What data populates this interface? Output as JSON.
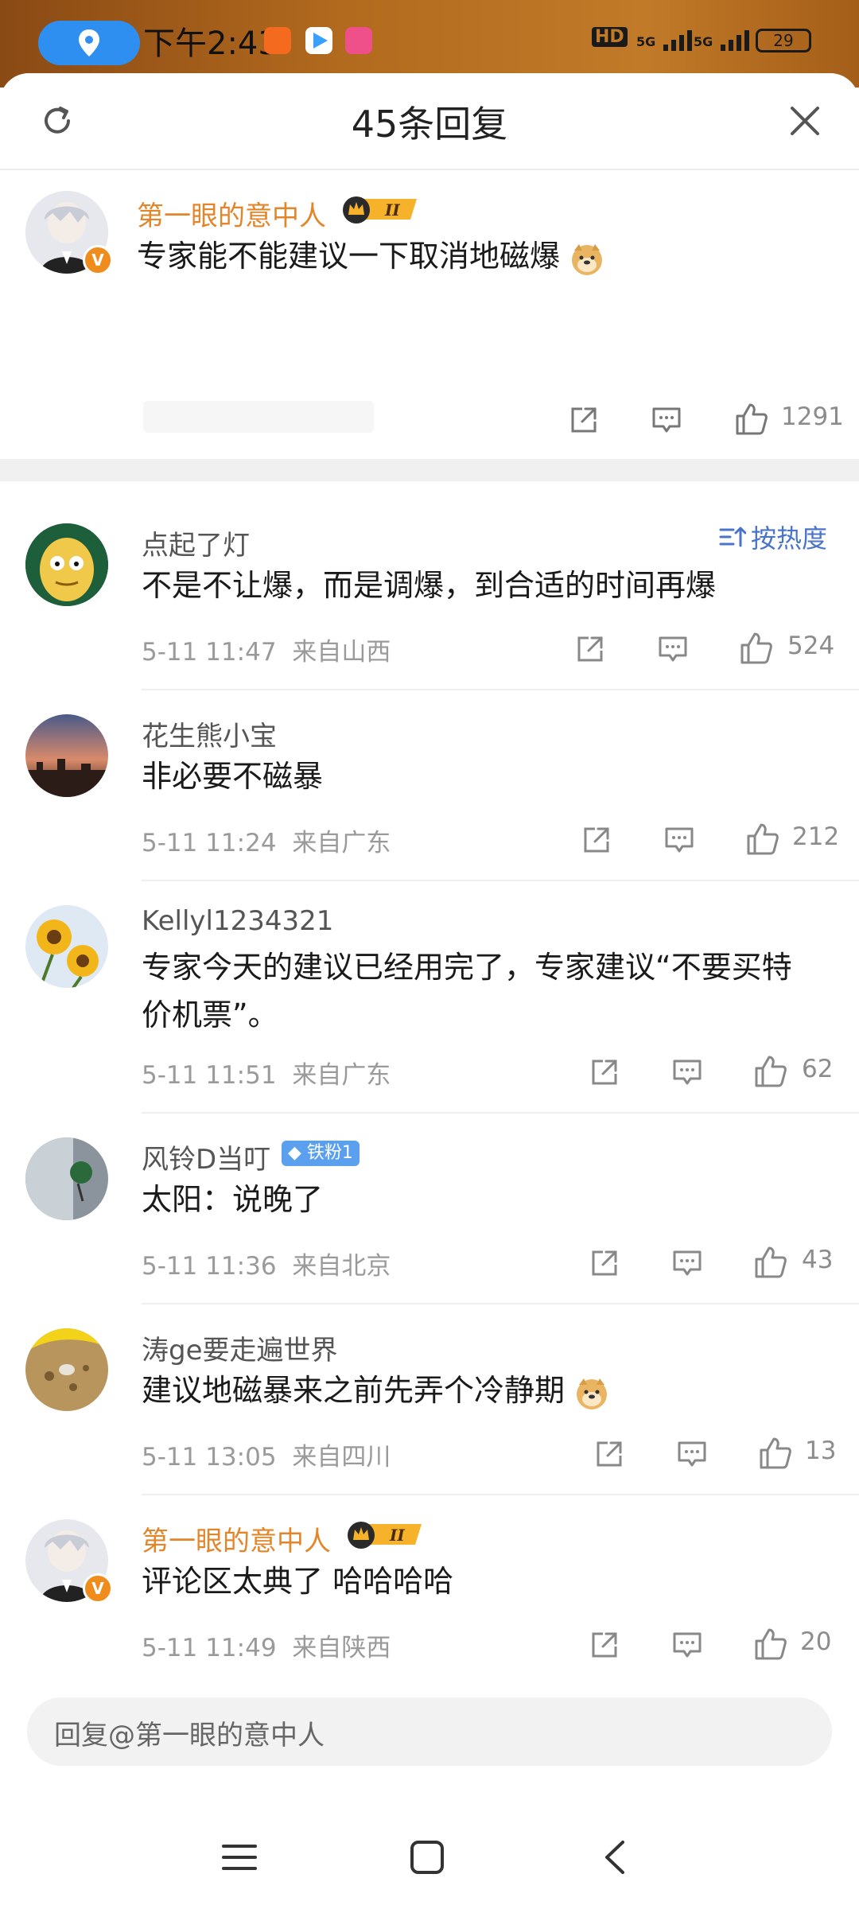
{
  "status_bar": {
    "time": "下午2:43",
    "signal_labels": [
      "HD",
      "5G",
      "5G"
    ],
    "battery": "29"
  },
  "header": {
    "title": "45条回复"
  },
  "main_post": {
    "user": "第一眼的意中人",
    "text": "专家能不能建议一下取消地磁爆",
    "likes": "1291"
  },
  "sort": {
    "label": "按热度"
  },
  "replies": [
    {
      "user": "点起了灯",
      "text": "不是不让爆，而是调爆，到合适的时间再爆",
      "time": "5-11 11:47",
      "location": "来自山西",
      "likes": "524"
    },
    {
      "user": "花生熊小宝",
      "text": "非必要不磁暴",
      "time": "5-11 11:24",
      "location": "来自广东",
      "likes": "212"
    },
    {
      "user": "Kellyl1234321",
      "text": "专家今天的建议已经用完了，专家建议“不要买特价机票”。",
      "time": "5-11 11:51",
      "location": "来自广东",
      "likes": "62"
    },
    {
      "user": "风铃D当叮",
      "fan_badge": "铁粉1",
      "text": "太阳：说晚了",
      "time": "5-11 11:36",
      "location": "来自北京",
      "likes": "43"
    },
    {
      "user": "涛ge要走遍世界",
      "text": "建议地磁暴来之前先弄个冷静期",
      "time": "5-11 13:05",
      "location": "来自四川",
      "likes": "13"
    },
    {
      "user": "第一眼的意中人",
      "text": "评论区太典了 哈哈哈哈",
      "time": "5-11 11:49",
      "location": "来自陕西",
      "likes": "20"
    }
  ],
  "reply_box": {
    "placeholder": "回复@第一眼的意中人"
  },
  "icons": [
    "location-icon",
    "refresh-icon",
    "close-icon",
    "share-icon",
    "comment-icon",
    "like-icon",
    "sort-icon",
    "menu-icon",
    "home-icon",
    "back-icon",
    "crown-badge-icon",
    "doge-emoji-icon",
    "verified-icon"
  ],
  "colors": {
    "vip_name": "#e3862a",
    "link_blue": "#4a74c9",
    "status_gradient": "#b26a1e"
  }
}
